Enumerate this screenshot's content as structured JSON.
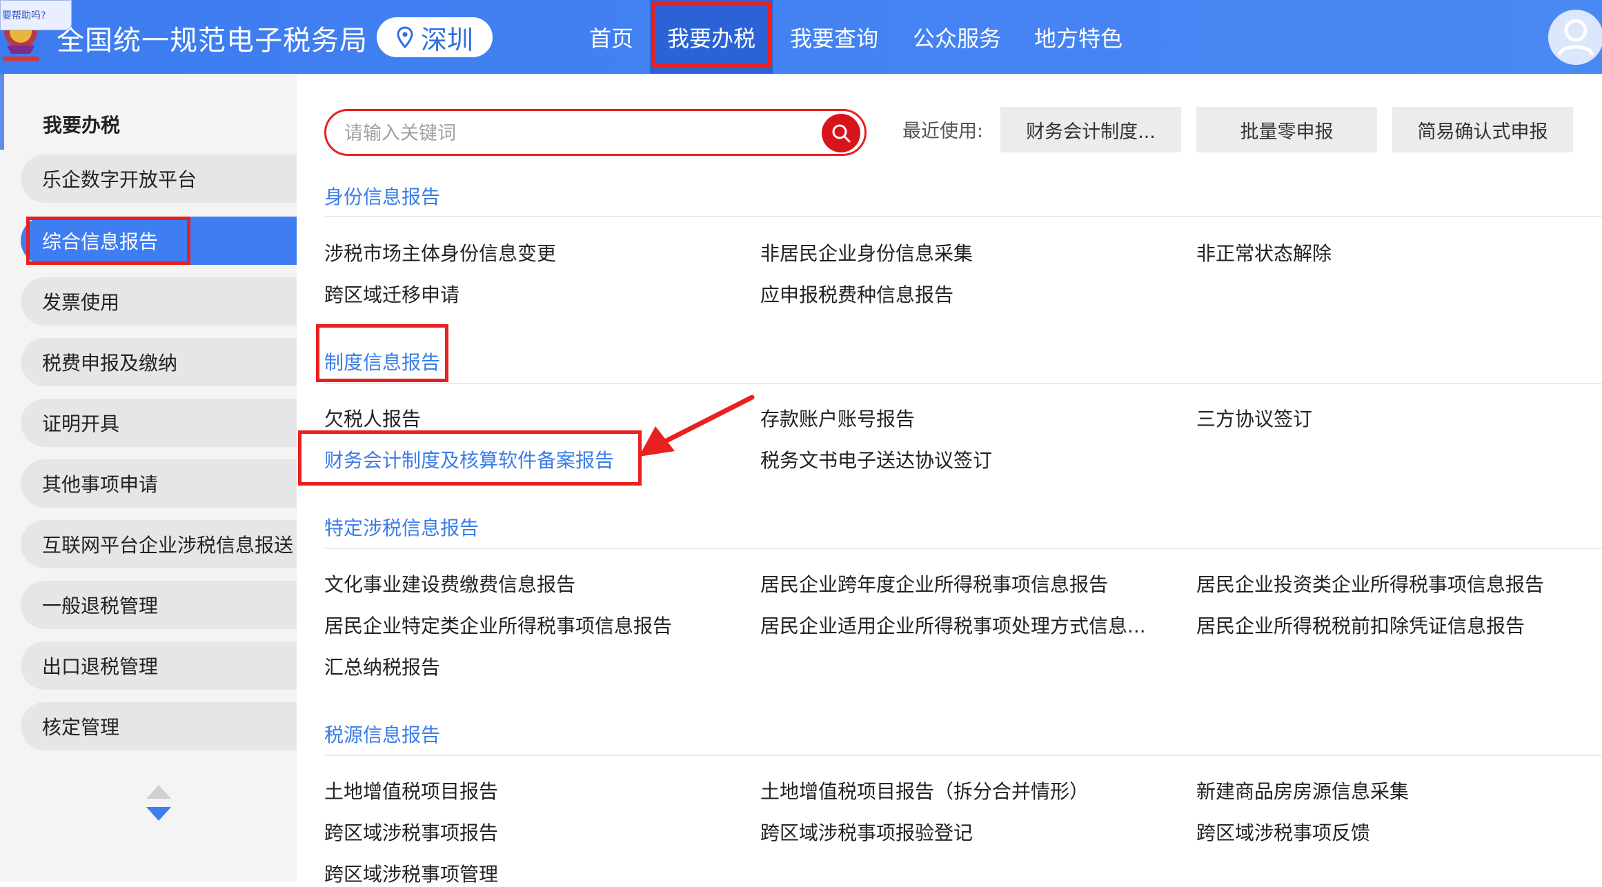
{
  "header": {
    "help_tip": "要帮助吗?",
    "title": "全国统一规范电子税务局",
    "city": "深圳",
    "nav": [
      {
        "label": "首页"
      },
      {
        "label": "我要办税"
      },
      {
        "label": "我要查询"
      },
      {
        "label": "公众服务"
      },
      {
        "label": "地方特色"
      }
    ],
    "active_nav": "我要办税"
  },
  "sidebar": {
    "title": "我要办税",
    "items": [
      {
        "label": "乐企数字开放平台"
      },
      {
        "label": "综合信息报告"
      },
      {
        "label": "发票使用"
      },
      {
        "label": "税费申报及缴纳"
      },
      {
        "label": "证明开具"
      },
      {
        "label": "其他事项申请"
      },
      {
        "label": "互联网平台企业涉税信息报送"
      },
      {
        "label": "一般退税管理"
      },
      {
        "label": "出口退税管理"
      },
      {
        "label": "核定管理"
      }
    ],
    "active_item": "综合信息报告"
  },
  "search": {
    "placeholder": "请输入关键词",
    "value": ""
  },
  "recent": {
    "label": "最近使用:",
    "chips": [
      {
        "label": "财务会计制度..."
      },
      {
        "label": "批量零申报"
      },
      {
        "label": "简易确认式申报"
      }
    ]
  },
  "sections": [
    {
      "title": "身份信息报告",
      "links": [
        "涉税市场主体身份信息变更",
        "非居民企业身份信息采集",
        "非正常状态解除",
        "跨区域迁移申请",
        "应申报税费种信息报告"
      ]
    },
    {
      "title": "制度信息报告",
      "links": [
        "欠税人报告",
        "存款账户账号报告",
        "三方协议签订",
        "财务会计制度及核算软件备案报告",
        "税务文书电子送达协议签订"
      ]
    },
    {
      "title": "特定涉税信息报告",
      "links": [
        "文化事业建设费缴费信息报告",
        "居民企业跨年度企业所得税事项信息报告",
        "居民企业投资类企业所得税事项信息报告",
        "居民企业特定类企业所得税事项信息报告",
        "居民企业适用企业所得税事项处理方式信息...",
        "居民企业所得税税前扣除凭证信息报告",
        "汇总纳税报告"
      ]
    },
    {
      "title": "税源信息报告",
      "links": [
        "土地增值税项目报告",
        "土地增值税项目报告（拆分合并情形）",
        "新建商品房房源信息采集",
        "跨区域涉税事项报告",
        "跨区域涉税事项报验登记",
        "跨区域涉税事项反馈",
        "跨区域涉税事项管理"
      ]
    }
  ],
  "colors": {
    "header_blue": "#4a88f4",
    "active_blue": "#3f7df2",
    "link_blue": "#3b7de8",
    "annotation_red": "#e8201f"
  }
}
